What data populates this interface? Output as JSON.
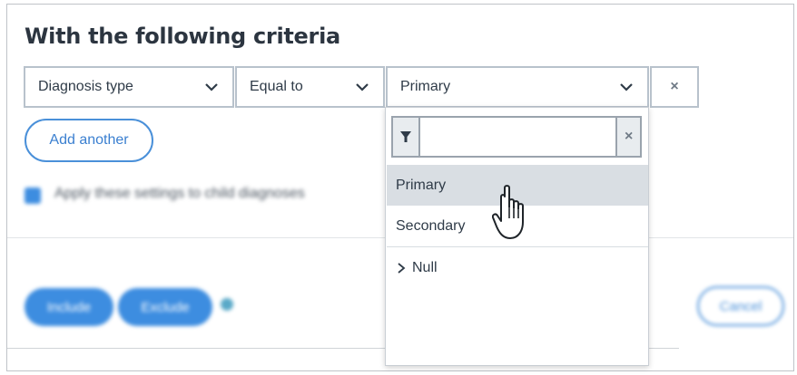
{
  "heading": "With the following criteria",
  "criteria": {
    "field": {
      "value": "Diagnosis type",
      "icon": "chevron-down-icon"
    },
    "operator": {
      "value": "Equal to",
      "icon": "chevron-down-icon"
    },
    "value": {
      "value": "Primary",
      "icon": "chevron-down-icon"
    },
    "remove": {
      "icon": "close-icon",
      "glyph": "×"
    }
  },
  "add_another_label": "Add another",
  "apply_child": {
    "label": "Apply these settings to child diagnoses",
    "checked": true
  },
  "actions": {
    "include_label": "Include",
    "exclude_label": "Exclude",
    "cancel_label": "Cancel",
    "info_icon": "info-icon"
  },
  "dropdown": {
    "filter_icon": "filter-icon",
    "filter_value": "",
    "clear_icon": "close-icon",
    "clear_glyph": "×",
    "options": [
      {
        "label": "Primary",
        "selected": true
      },
      {
        "label": "Secondary",
        "selected": false
      }
    ],
    "group": {
      "label": "Null",
      "icon": "chevron-right-icon"
    }
  },
  "colors": {
    "accent": "#3d8de0",
    "selected_bg": "#d9dee3",
    "border": "#b8c2cc"
  }
}
